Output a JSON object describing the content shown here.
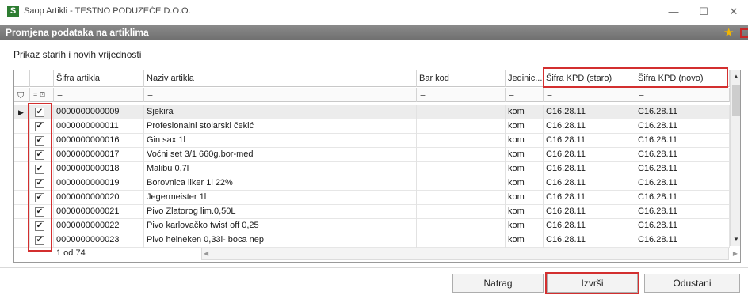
{
  "window": {
    "app_icon_letter": "S",
    "title": "Saop Artikli - TESTNO PODUZEĆE D.O.O.",
    "minimize_glyph": "—",
    "maximize_glyph": "☐",
    "close_glyph": "✕"
  },
  "header": {
    "title": "Promjena podataka na artiklima",
    "favorite_icon": "star-icon"
  },
  "subtitle": "Prikaz starih i novih vrijednosti",
  "grid": {
    "columns": [
      "Šifra artikla",
      "Naziv artikla",
      "Bar kod",
      "Jedinic...",
      "Šifra KPD (staro)",
      "Šifra KPD (novo)"
    ],
    "filter_glyph": "=",
    "rows": [
      {
        "checked": true,
        "sifra": "0000000000009",
        "naziv": "Sjekira",
        "barkod": "",
        "jedinica": "kom",
        "kpd_staro": "C16.28.11",
        "kpd_novo": "C16.28.11"
      },
      {
        "checked": true,
        "sifra": "0000000000011",
        "naziv": "Profesionalni stolarski čekić",
        "barkod": "",
        "jedinica": "kom",
        "kpd_staro": "C16.28.11",
        "kpd_novo": "C16.28.11"
      },
      {
        "checked": true,
        "sifra": "0000000000016",
        "naziv": "Gin sax 1l",
        "barkod": "",
        "jedinica": "kom",
        "kpd_staro": "C16.28.11",
        "kpd_novo": "C16.28.11"
      },
      {
        "checked": true,
        "sifra": "0000000000017",
        "naziv": "Voćni set 3/1 660g.bor-med",
        "barkod": "",
        "jedinica": "kom",
        "kpd_staro": "C16.28.11",
        "kpd_novo": "C16.28.11"
      },
      {
        "checked": true,
        "sifra": "0000000000018",
        "naziv": "Malibu 0,7l",
        "barkod": "",
        "jedinica": "kom",
        "kpd_staro": "C16.28.11",
        "kpd_novo": "C16.28.11"
      },
      {
        "checked": true,
        "sifra": "0000000000019",
        "naziv": "Borovnica liker 1l 22%",
        "barkod": "",
        "jedinica": "kom",
        "kpd_staro": "C16.28.11",
        "kpd_novo": "C16.28.11"
      },
      {
        "checked": true,
        "sifra": "0000000000020",
        "naziv": "Jegermeister 1l",
        "barkod": "",
        "jedinica": "kom",
        "kpd_staro": "C16.28.11",
        "kpd_novo": "C16.28.11"
      },
      {
        "checked": true,
        "sifra": "0000000000021",
        "naziv": "Pivo Zlatorog lim.0,50L",
        "barkod": "",
        "jedinica": "kom",
        "kpd_staro": "C16.28.11",
        "kpd_novo": "C16.28.11"
      },
      {
        "checked": true,
        "sifra": "0000000000022",
        "naziv": "Pivo karlovačko twist off 0,25",
        "barkod": "",
        "jedinica": "kom",
        "kpd_staro": "C16.28.11",
        "kpd_novo": "C16.28.11"
      },
      {
        "checked": true,
        "sifra": "0000000000023",
        "naziv": "Pivo heineken 0,33l- boca nep",
        "barkod": "",
        "jedinica": "kom",
        "kpd_staro": "C16.28.11",
        "kpd_novo": "C16.28.11"
      }
    ],
    "record_counter": "1 od 74"
  },
  "buttons": {
    "natrag": "Natrag",
    "izvrsi": "Izvrši",
    "odustani": "Odustani"
  },
  "colors": {
    "highlight": "#d32f2f",
    "header_bar": "#7a7a7a",
    "app_icon": "#2e7d32",
    "star": "#f2b600"
  }
}
